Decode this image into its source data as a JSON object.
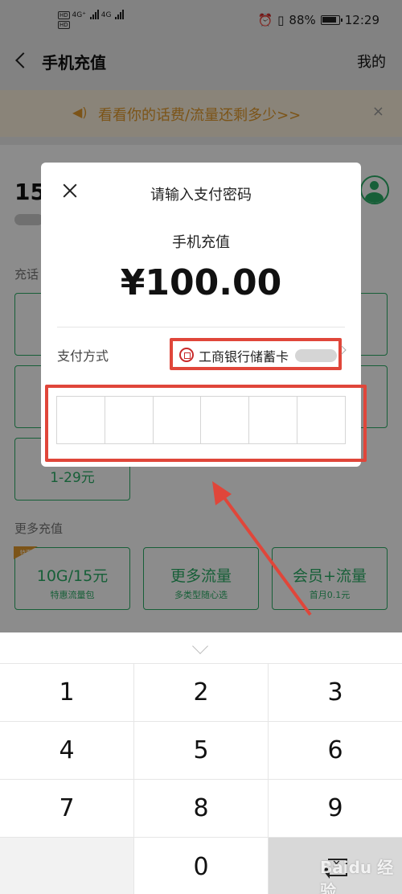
{
  "status_bar": {
    "network_1": "4G⁺",
    "network_2": "4G",
    "battery": "88%",
    "time": "12:29"
  },
  "nav": {
    "title": "手机充值",
    "right_link": "我的"
  },
  "banner": {
    "text": "看看你的话费/流量还剩多少>>"
  },
  "background": {
    "phone_fragment": "15",
    "section_recharge_fragment": "充话",
    "tile_partial": "1-29元",
    "section_more": "更多充值",
    "more_tiles": [
      {
        "title": "10G/15元",
        "subtitle": "特惠流量包",
        "tag": "特惠"
      },
      {
        "title": "更多流量",
        "subtitle": "多类型随心选"
      },
      {
        "title": "会员+流量",
        "subtitle": "首月0.1元"
      }
    ]
  },
  "modal": {
    "title": "请输入支付密码",
    "product": "手机充值",
    "amount": "¥100.00",
    "pay_method_label": "支付方式",
    "pay_method_value": "工商银行储蓄卡"
  },
  "keypad": {
    "keys": [
      "1",
      "2",
      "3",
      "4",
      "5",
      "6",
      "7",
      "8",
      "9",
      "",
      "0",
      ""
    ]
  },
  "watermark": "Baidu 经验",
  "colors": {
    "accent_green": "#2aae67",
    "banner_orange": "#e29a2c",
    "highlight_red": "#e0463a"
  }
}
